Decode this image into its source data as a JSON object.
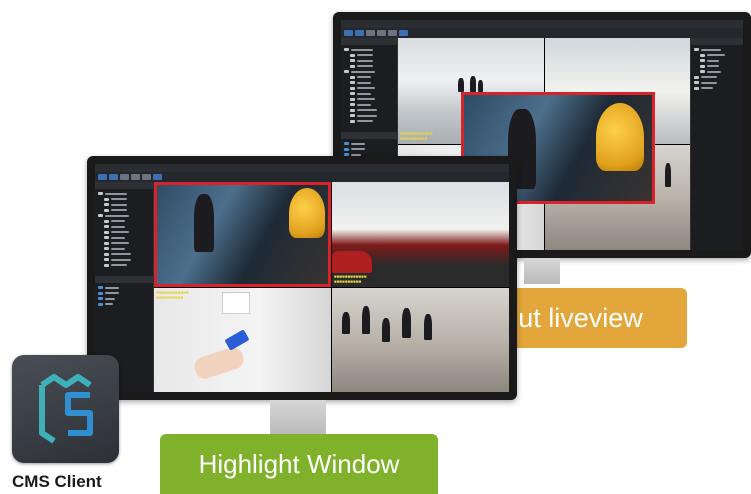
{
  "app": {
    "name": "CMS Client"
  },
  "labels": {
    "popout": "pop-out liveview",
    "highlight": "Highlight Window"
  },
  "colors": {
    "popout_badge": "#e2a63a",
    "highlight_badge": "#7fb22a",
    "highlight_border": "#d8232a",
    "osd_text": "#e8d24a",
    "logo_teal": "#3fb0b8",
    "logo_blue": "#2f8fd0"
  },
  "icons": {
    "logo": "cms-logo-icon"
  }
}
